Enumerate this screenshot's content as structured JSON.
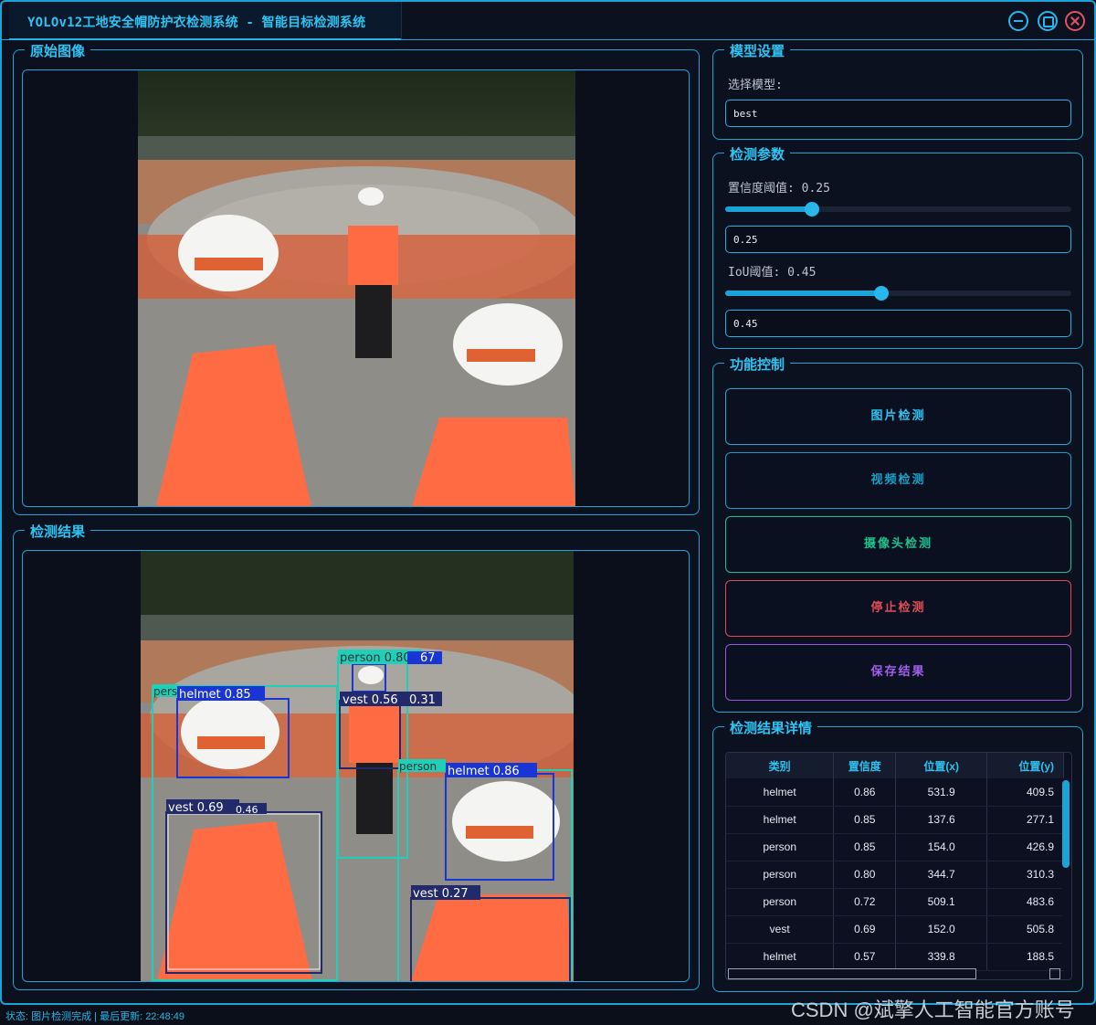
{
  "window": {
    "title": "YOLOv12工地安全帽防护衣检测系统 - 智能目标检测系统"
  },
  "panels": {
    "original": {
      "title": "原始图像"
    },
    "result": {
      "title": "检测结果"
    }
  },
  "model_settings": {
    "title": "模型设置",
    "select_label": "选择模型:",
    "model_value": "best"
  },
  "detection_params": {
    "title": "检测参数",
    "confidence_label": "置信度阈值: 0.25",
    "confidence_value": "0.25",
    "confidence_level": 0.25,
    "iou_label": "IoU阈值: 0.45",
    "iou_value": "0.45",
    "iou_level": 0.45
  },
  "controls": {
    "title": "功能控制",
    "image_detect": "图片检测",
    "video_detect": "视频检测",
    "camera_detect": "摄像头检测",
    "stop_detect": "停止检测",
    "save_result": "保存结果"
  },
  "results_detail": {
    "title": "检测结果详情",
    "columns": [
      "类别",
      "置信度",
      "位置(x)",
      "位置(y)"
    ],
    "rows": [
      [
        "helmet",
        "0.86",
        "531.9",
        "409.5"
      ],
      [
        "helmet",
        "0.85",
        "137.6",
        "277.1"
      ],
      [
        "person",
        "0.85",
        "154.0",
        "426.9"
      ],
      [
        "person",
        "0.80",
        "344.7",
        "310.3"
      ],
      [
        "person",
        "0.72",
        "509.1",
        "483.6"
      ],
      [
        "vest",
        "0.69",
        "152.0",
        "505.8"
      ],
      [
        "helmet",
        "0.57",
        "339.8",
        "188.5"
      ]
    ]
  },
  "detections": [
    {
      "label": "helmet 0.85"
    },
    {
      "label": "person 0.80"
    },
    {
      "label": "vest 0.56"
    },
    {
      "label": "0.31"
    },
    {
      "label": "helmet 0.86"
    },
    {
      "label": "vest 0.69"
    },
    {
      "label": "vest 0.27"
    },
    {
      "label": "pers"
    },
    {
      "label": "person"
    },
    {
      "label": "67"
    },
    {
      "label": "0.46"
    }
  ],
  "status": {
    "text": "状态: 图片检测完成 | 最后更新: 22:48:49"
  },
  "watermark": "CSDN @斌擎人工智能官方账号",
  "colors": {
    "accent": "#1aa3d6",
    "video_button": "#17a0c8",
    "camera_button": "#1fc08e",
    "stop_button": "#e04b57",
    "save_button": "#9a55e0"
  }
}
